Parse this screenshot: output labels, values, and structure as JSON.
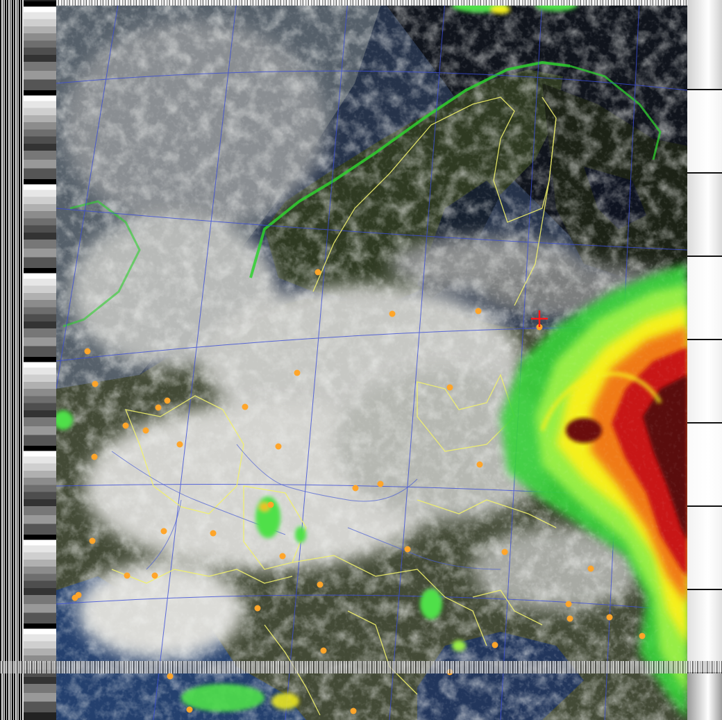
{
  "image": {
    "subject": "weather-satellite-false-color-image",
    "colors": {
      "ocean": "#1c2f52",
      "cloud": "#cfd0cc",
      "land": "#3c4424",
      "coast_green": "#2fd12f",
      "border_yellow": "#f2f26b",
      "grid_blue": "#3a4cd8",
      "city_orange": "#ffa52a",
      "marker_red": "#ff1a1a",
      "precip_light": "#9cf046",
      "precip_yellow": "#f5f01e",
      "precip_orange": "#f07a18",
      "precip_red": "#c81414",
      "precip_darkred": "#5a0a0a"
    },
    "icons": {
      "receiver-marker": "red-cross",
      "city": "orange-dot"
    }
  }
}
